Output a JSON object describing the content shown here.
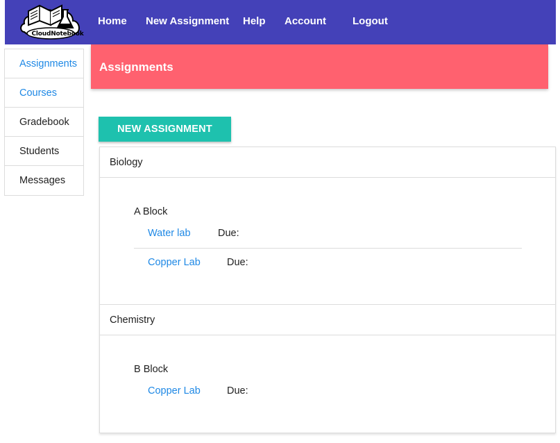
{
  "app": {
    "logo_text": "CloudNotebook"
  },
  "nav": {
    "home": "Home",
    "new_assignment": "New Assignment",
    "help": "Help",
    "account": "Account",
    "logout": "Logout"
  },
  "sidebar": {
    "items": [
      {
        "label": "Assignments",
        "active": true
      },
      {
        "label": "Courses",
        "active": true
      },
      {
        "label": "Gradebook",
        "active": false
      },
      {
        "label": "Students",
        "active": false
      },
      {
        "label": "Messages",
        "active": false
      }
    ]
  },
  "page": {
    "title": "Assignments",
    "new_button": "NEW ASSIGNMENT"
  },
  "courses": [
    {
      "name": "Biology",
      "blocks": [
        {
          "label": "A Block",
          "assignments": [
            {
              "title": "Water lab",
              "due_label": "Due:"
            },
            {
              "title": "Copper Lab",
              "due_label": "Due:"
            }
          ]
        }
      ]
    },
    {
      "name": "Chemistry",
      "blocks": [
        {
          "label": "B Block",
          "assignments": [
            {
              "title": "Copper Lab",
              "due_label": "Due:"
            }
          ]
        }
      ]
    }
  ],
  "colors": {
    "topbar": "#4441b8",
    "banner": "#ff616f",
    "button": "#1ec1ae",
    "link": "#1e88e5"
  },
  "icons": {
    "logo": "book-flask-cloud-logo"
  }
}
